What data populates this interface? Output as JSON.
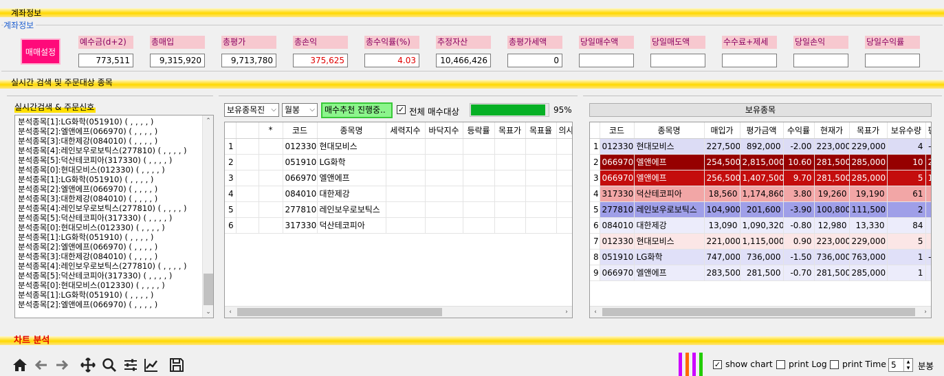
{
  "sections": {
    "account_band": "계좌정보",
    "account_caption": "계좌정보",
    "realtime_band": "실시간 검색 및 주문대상 종목",
    "chart_band": "차트 분석"
  },
  "account": {
    "trade_settings_button": "매매설정",
    "metrics": [
      {
        "label": "예수금(d+2)",
        "value": "773,511"
      },
      {
        "label": "총매입",
        "value": "9,315,920"
      },
      {
        "label": "총평가",
        "value": "9,713,780"
      },
      {
        "label": "총손익",
        "value": "375,625"
      },
      {
        "label": "총수익률(%)",
        "value": "4.03"
      },
      {
        "label": "추정자산",
        "value": "10,466,426"
      },
      {
        "label": "총평가세액",
        "value": "0"
      },
      {
        "label": "당일매수액",
        "value": ""
      },
      {
        "label": "당일매도액",
        "value": ""
      },
      {
        "label": "수수료+제세",
        "value": ""
      },
      {
        "label": "당일손익",
        "value": ""
      },
      {
        "label": "당일수익률",
        "value": ""
      }
    ]
  },
  "signals": {
    "title": "실시간검색 & 주문신호",
    "lines": [
      "분석종목[1]:LG화학(051910) ( , , , , )",
      "분석종목[2]:엘앤에프(066970) ( , , , , )",
      "분석종목[3]:대한제강(084010) ( , , , , )",
      "분석종목[4]:레인보우로보틱스(277810) ( , , , , )",
      "분석종목[5]:덕산테코피아(317330) ( , , , , )",
      "분석종목[0]:현대모비스(012330) ( , , , , )",
      "분석종목[1]:LG화학(051910) ( , , , , )",
      "분석종목[2]:엘앤에프(066970) ( , , , , )",
      "분석종목[3]:대한제강(084010) ( , , , , )",
      "분석종목[4]:레인보우로보틱스(277810) ( , , , , )",
      "분석종목[5]:덕산테코피아(317330) ( , , , , )",
      "분석종목[0]:현대모비스(012330) ( , , , , )",
      "분석종목[1]:LG화학(051910) ( , , , , )",
      "분석종목[2]:엘앤에프(066970) ( , , , , )",
      "분석종목[3]:대한제강(084010) ( , , , , )",
      "분석종목[4]:레인보우로보틱스(277810) ( , , , , )",
      "분석종목[5]:덕산테코피아(317330) ( , , , , )",
      "분석종목[0]:현대모비스(012330) ( , , , , )",
      "분석종목[1]:LG화학(051910) ( , , , , )",
      "분석종목[2]:엘앤에프(066970) ( , , , , )"
    ]
  },
  "targets": {
    "source_combo": "보유종목진",
    "period_combo": "월봉",
    "recommend_button": "매수추천 진행중..",
    "all_buy_label": "전체 매수대상",
    "all_buy_checked": true,
    "progress_percent": 95,
    "progress_text": "95%",
    "columns": [
      "",
      "",
      "*",
      "코드",
      "종목명",
      "세력지수",
      "바닥지수",
      "등락률",
      "목표가",
      "목표율",
      "의사"
    ],
    "rows": [
      [
        "1",
        "",
        "",
        "012330",
        "현대모비스",
        "",
        "",
        "",
        "",
        "",
        ""
      ],
      [
        "2",
        "",
        "",
        "051910",
        "LG화학",
        "",
        "",
        "",
        "",
        "",
        ""
      ],
      [
        "3",
        "",
        "",
        "066970",
        "엘앤에프",
        "",
        "",
        "",
        "",
        "",
        ""
      ],
      [
        "4",
        "",
        "",
        "084010",
        "대한제강",
        "",
        "",
        "",
        "",
        "",
        ""
      ],
      [
        "5",
        "",
        "",
        "277810",
        "레인보우로보틱스",
        "",
        "",
        "",
        "",
        "",
        ""
      ],
      [
        "6",
        "",
        "",
        "317330",
        "덕산테코피아",
        "",
        "",
        "",
        "",
        "",
        ""
      ]
    ]
  },
  "holdings": {
    "title": "보유종목",
    "columns": [
      "",
      "코드",
      "종목명",
      "매입가",
      "평가금액",
      "수익률",
      "현재가",
      "목표가",
      "보유수량",
      "평"
    ],
    "rows": [
      {
        "cells": [
          "1",
          "012330",
          "현대모비스",
          "227,500",
          "892,000",
          "-2.00",
          "223,000",
          "229,000",
          "4",
          "-"
        ],
        "bg": "#dcdcf5",
        "fg": "#000000"
      },
      {
        "cells": [
          "2",
          "066970",
          "엘앤에프",
          "254,500",
          "2,815,000",
          "10.60",
          "281,500",
          "285,000",
          "10",
          "2"
        ],
        "bg": "#960000",
        "fg": "#ffffff"
      },
      {
        "cells": [
          "3",
          "066970",
          "엘앤에프",
          "256,500",
          "1,407,500",
          "9.70",
          "281,500",
          "285,000",
          "5",
          "1"
        ],
        "bg": "#c40d0d",
        "fg": "#ffffff"
      },
      {
        "cells": [
          "4",
          "317330",
          "덕산테코피아",
          "18,560",
          "1,174,860",
          "3.80",
          "19,260",
          "19,190",
          "61",
          ""
        ],
        "bg": "#f2a6a6",
        "fg": "#000000"
      },
      {
        "cells": [
          "5",
          "277810",
          "레인보우로보틱스",
          "104,900",
          "201,600",
          "-3.90",
          "100,800",
          "111,500",
          "2",
          ""
        ],
        "bg": "#9f9fe8",
        "fg": "#000000"
      },
      {
        "cells": [
          "6",
          "084010",
          "대한제강",
          "13,090",
          "1,090,320",
          "-0.80",
          "12,980",
          "13,330",
          "84",
          ""
        ],
        "bg": "#ececfb",
        "fg": "#000000"
      },
      {
        "cells": [
          "7",
          "012330",
          "현대모비스",
          "221,000",
          "1,115,000",
          "0.90",
          "223,000",
          "229,000",
          "5",
          ""
        ],
        "bg": "#fbe6e6",
        "fg": "#000000"
      },
      {
        "cells": [
          "8",
          "051910",
          "LG화학",
          "747,000",
          "736,000",
          "-1.50",
          "736,000",
          "763,000",
          "1",
          "-"
        ],
        "bg": "#e0e0f8",
        "fg": "#000000"
      },
      {
        "cells": [
          "9",
          "066970",
          "엘앤에프",
          "283,500",
          "281,500",
          "-0.70",
          "281,500",
          "285,000",
          "1",
          ""
        ],
        "bg": "#ececfb",
        "fg": "#000000"
      }
    ]
  },
  "toolbar": {
    "tools": [
      "home-icon",
      "back-arrow-icon",
      "forward-arrow-icon",
      "pan-icon",
      "zoom-icon",
      "configure-subplots-icon",
      "edit-axis-icon",
      "save-icon"
    ],
    "color_bars": [
      "#cc00ff",
      "#ff6a00",
      "#cc00ff",
      "#22cc00"
    ],
    "show_chart_label": "show chart",
    "show_chart_checked": true,
    "print_log_label": "print Log",
    "print_log_checked": false,
    "print_time_label": "print Time",
    "print_time_checked": false,
    "interval_value": "5",
    "interval_unit": "분봉"
  }
}
